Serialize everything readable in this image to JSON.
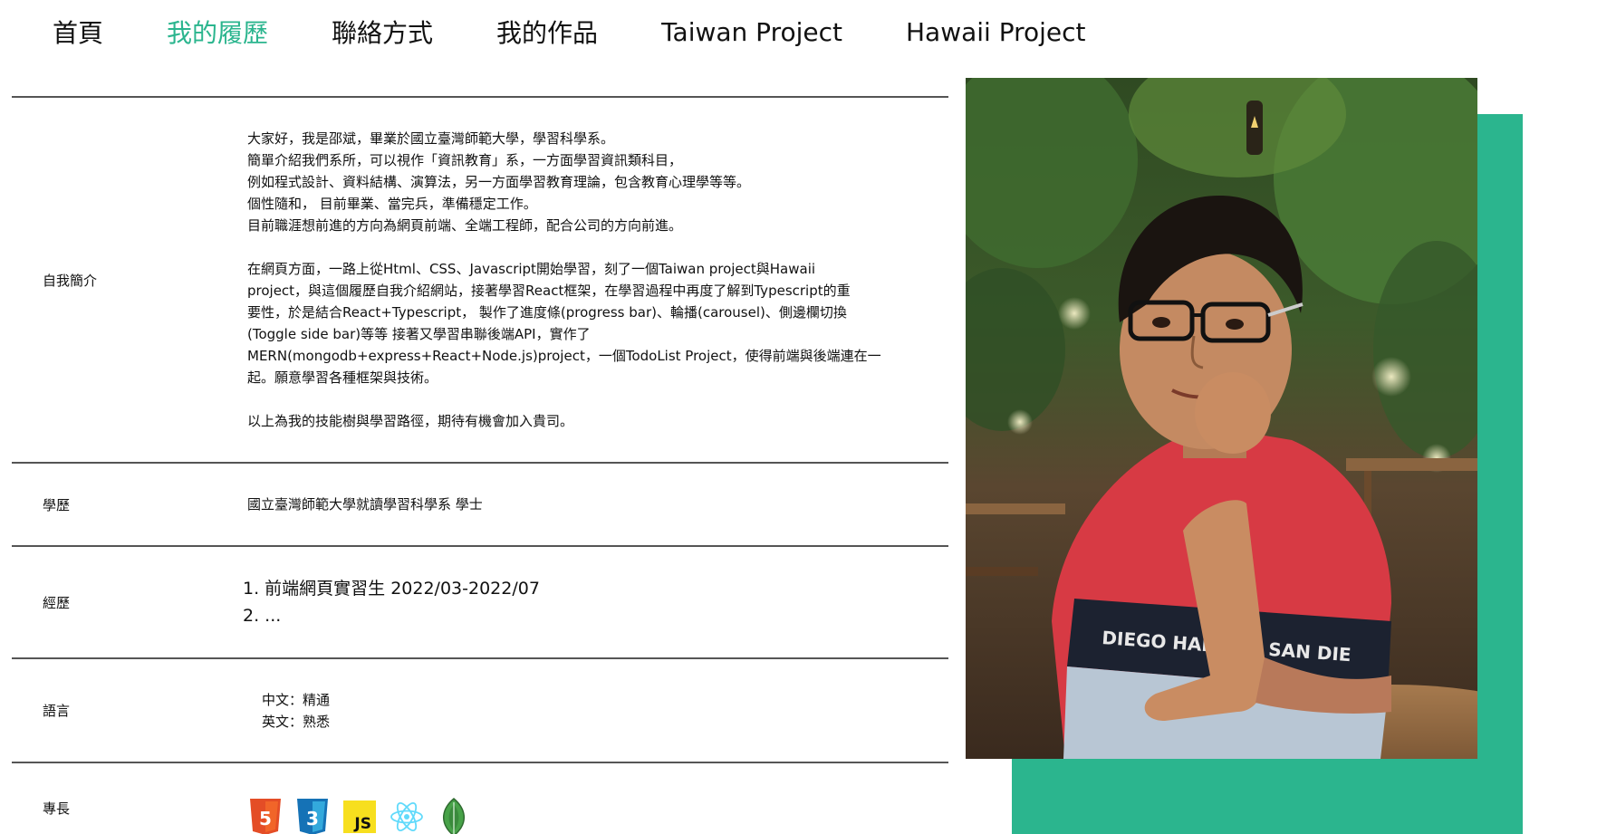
{
  "nav": {
    "items": [
      {
        "label": "首頁",
        "active": false
      },
      {
        "label": "我的履歷",
        "active": true
      },
      {
        "label": "聯絡方式",
        "active": false
      },
      {
        "label": "我的作品",
        "active": false
      },
      {
        "label": "Taiwan Project",
        "active": false
      },
      {
        "label": "Hawaii Project",
        "active": false
      }
    ]
  },
  "resume": {
    "intro": {
      "label": "自我簡介",
      "p1": [
        "大家好，我是邵斌，畢業於國立臺灣師範大學，學習科學系。",
        "簡單介紹我們系所，可以視作「資訊教育」系，一方面學習資訊類科目，",
        "例如程式設計、資料結構、演算法，另一方面學習教育理論，包含教育心理學等等。",
        "個性隨和， 目前畢業、當完兵，準備穩定工作。",
        "目前職涯想前進的方向為網頁前端、全端工程師，配合公司的方向前進。"
      ],
      "p2": [
        "在網頁方面，一路上從Html、CSS、Javascript開始學習，刻了一個Taiwan project與Hawaii",
        "project，與這個履歷自我介紹網站，接著學習React框架，在學習過程中再度了解到Typescript的重",
        "要性，於是結合React+Typescript， 製作了進度條(progress bar)、輪播(carousel)、側邊欄切換",
        "(Toggle side bar)等等 接著又學習串聯後端API，實作了",
        "MERN(mongodb+express+React+Node.js)project，一個TodoList Project，使得前端與後端連在一",
        "起。願意學習各種框架與技術。"
      ],
      "p3": "以上為我的技能樹與學習路徑，期待有機會加入貴司。"
    },
    "education": {
      "label": "學歷",
      "value": "國立臺灣師範大學就讀學習科學系 學士"
    },
    "experience": {
      "label": "經歷",
      "items": [
        "1. 前端網頁實習生 2022/03-2022/07",
        "2. ..."
      ]
    },
    "language": {
      "label": "語言",
      "items": [
        "中文：精通",
        "英文：熟悉"
      ]
    },
    "skills": {
      "label": "專長",
      "icons": [
        "html5-icon",
        "css3-icon",
        "javascript-icon",
        "react-icon",
        "mongodb-icon"
      ]
    }
  },
  "photo": {
    "shirt_text": "DIEGO HANG'10 SAN DIE"
  },
  "colors": {
    "accent": "#2bb58e",
    "html5": "#e44d26",
    "css3": "#1572b6",
    "javascript": "#f7df1e",
    "react": "#61dafb",
    "mongodb": "#47a248"
  }
}
